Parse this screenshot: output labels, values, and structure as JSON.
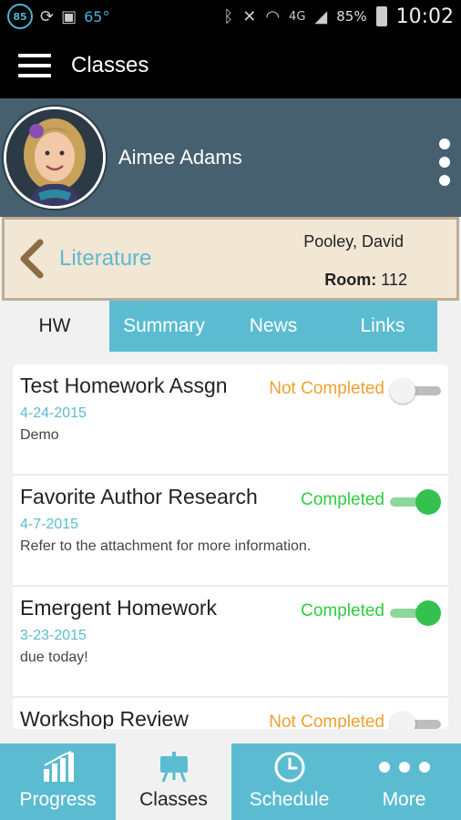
{
  "status_bar": {
    "badge": "85",
    "temperature": "65°",
    "network": "4G",
    "battery": "85%",
    "time": "10:02"
  },
  "app_bar": {
    "title": "Classes"
  },
  "profile": {
    "name": "Aimee Adams"
  },
  "class_header": {
    "class_name": "Literature",
    "teacher": "Pooley, David",
    "room_label": "Room:",
    "room_value": "112"
  },
  "tabs": [
    {
      "label": "HW",
      "active": true
    },
    {
      "label": "Summary",
      "active": false
    },
    {
      "label": "News",
      "active": false
    },
    {
      "label": "Links",
      "active": false
    }
  ],
  "assignments": [
    {
      "title": "Test Homework Assgn",
      "status": "Not Completed",
      "date": "4-24-2015",
      "description": "Demo",
      "completed": false
    },
    {
      "title": "Favorite Author Research",
      "status": "Completed",
      "date": "4-7-2015",
      "description": "Refer to the attachment for more information.",
      "completed": true
    },
    {
      "title": "Emergent Homework",
      "status": "Completed",
      "date": "3-23-2015",
      "description": "due today!",
      "completed": true
    },
    {
      "title": "Workshop Review",
      "status": "Not Completed",
      "date": "",
      "description": "",
      "completed": false
    }
  ],
  "bottom_nav": [
    {
      "label": "Progress",
      "icon": "bar-chart-icon",
      "active": false
    },
    {
      "label": "Classes",
      "icon": "easel-icon",
      "active": true
    },
    {
      "label": "Schedule",
      "icon": "clock-icon",
      "active": false
    },
    {
      "label": "More",
      "icon": "dots-icon",
      "active": false
    }
  ],
  "colors": {
    "accent": "#5bbcd1",
    "profile_bg": "#46606f",
    "not_completed": "#f0a030",
    "completed": "#2ecc40"
  }
}
